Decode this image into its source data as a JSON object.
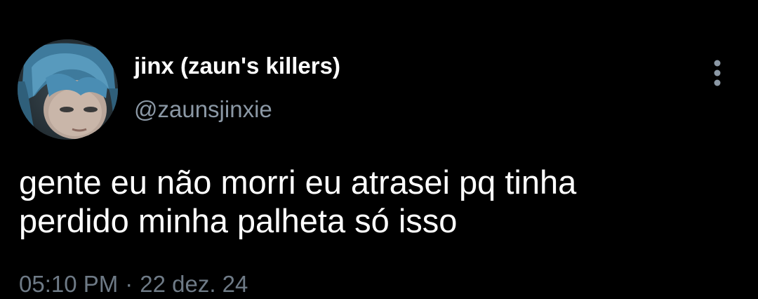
{
  "author": {
    "display_name": "jinx (zaun's killers)",
    "handle": "@zaunsjinxie",
    "avatar_icon": "profile-photo"
  },
  "tweet": {
    "text_lines": [
      "gente eu não morri eu atrasei pq tinha",
      "perdido minha palheta só isso"
    ]
  },
  "meta": {
    "time": "05:10 PM",
    "separator": "·",
    "date": "22 dez. 24"
  },
  "more_icon": "more-vertical-icon",
  "colors": {
    "background": "#000000",
    "text": "#ffffff",
    "secondary_text": "#8b98a5",
    "meta_text": "#6e7a86"
  }
}
